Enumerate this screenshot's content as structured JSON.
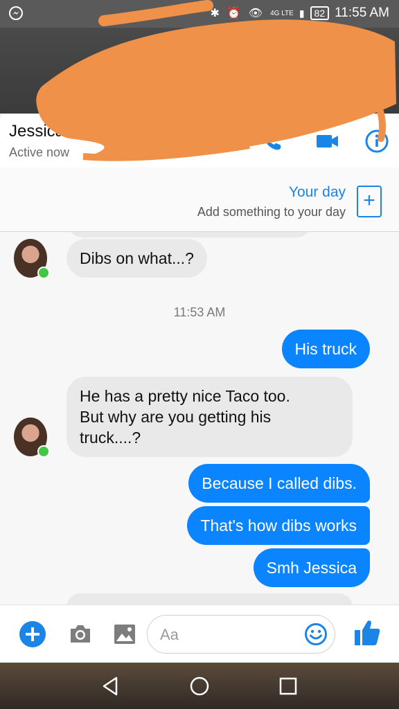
{
  "status_bar": {
    "network": "4G LTE",
    "battery": "82",
    "time": "11:55 AM"
  },
  "header": {
    "contact_name": "Jessica",
    "contact_status": "Active now",
    "icons": [
      "phone-icon",
      "video-icon",
      "info-icon"
    ],
    "accent": "#1a84e7"
  },
  "your_day": {
    "title": "Your day",
    "subtitle": "Add something to your day",
    "add_symbol": "+"
  },
  "thread": {
    "incoming_color": "#e9e9e9",
    "outgoing_color": "#0a84ff",
    "messages": [
      {
        "from": "them",
        "text": "Dibs on what...?"
      },
      {
        "type": "timestamp",
        "text": "11:53 AM"
      },
      {
        "from": "me",
        "text": "His truck"
      },
      {
        "from": "them",
        "lines": [
          "He has a pretty nice Taco too.",
          "But why are you getting his",
          "truck....?"
        ]
      },
      {
        "from": "me",
        "text": "Because I called dibs."
      },
      {
        "from": "me",
        "text": "That's how dibs works"
      },
      {
        "from": "me",
        "text": "Smh Jessica"
      }
    ]
  },
  "composer": {
    "placeholder": "Aa",
    "value": "",
    "icons": [
      "plus-icon",
      "camera-icon",
      "gallery-icon",
      "emoji-icon",
      "thumbs-up-icon"
    ]
  },
  "nav_bar": {
    "icons": [
      "back-icon",
      "home-icon",
      "recents-icon"
    ]
  }
}
